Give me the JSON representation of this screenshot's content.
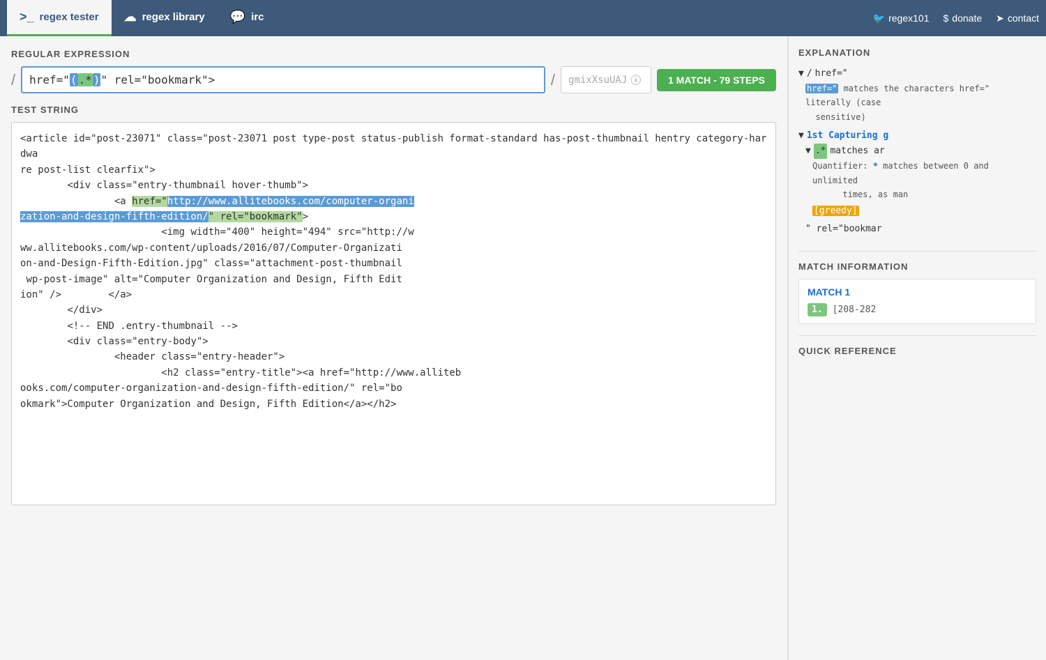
{
  "nav": {
    "tabs": [
      {
        "id": "regex-tester",
        "label": "regex tester",
        "icon": ">_",
        "active": true
      },
      {
        "id": "regex-library",
        "label": "regex library",
        "icon": "☁",
        "active": false
      },
      {
        "id": "irc",
        "label": "irc",
        "icon": "💬",
        "active": false
      }
    ],
    "right_links": [
      {
        "id": "twitter",
        "label": "regex101",
        "icon": "🐦"
      },
      {
        "id": "donate",
        "label": "donate",
        "icon": "$"
      },
      {
        "id": "contact",
        "label": "contact",
        "icon": "➤"
      }
    ]
  },
  "left": {
    "section_regex": "REGULAR EXPRESSION",
    "section_test": "TEST STRING",
    "match_badge": "1 MATCH - 79 STEPS",
    "regex_prefix": "/",
    "regex_suffix": "/",
    "flags_placeholder": "gmixXsuUAJ",
    "test_string": "<article id=\"post-23071\" class=\"post-23071 post type-post status-publish format-standard has-post-thumbnail hentry category-hardwa\nre post-list clearfix\">\n        <div class=\"entry-thumbnail hover-thumb\">\n                <a href=\"http://www.allitebooks.com/computer-organi\nzation-and-design-fifth-edition/\" rel=\"bookmark\">\n                        <img width=\"400\" height=\"494\" src=\"http://w\nww.allitebooks.com/wp-content/uploads/2016/07/Computer-Organizati\non-and-Design-Fifth-Edition.jpg\" class=\"attachment-post-thumbnail\n wp-post-image\" alt=\"Computer Organization and Design, Fifth Edit\nion\" />        </a>\n        </div>\n        <!-- END .entry-thumbnail -->\n        <div class=\"entry-body\">\n                <header class=\"entry-header\">\n                        <h2 class=\"entry-title\"><a href=\"http://www.alliteb\nooks.com/computer-organization-and-design-fifth-edition/\" rel=\"bo\nokmark\">Computer Organization and Design, Fifth Edition</a></h2>"
  },
  "right": {
    "explanation_title": "EXPLANATION",
    "exp_nodes": [
      {
        "depth": 0,
        "type": "collapse",
        "text": "/ href=\"",
        "token_type": "normal"
      },
      {
        "depth": 1,
        "text": "href=\" matches the characters href=\" literally (case sensitive)",
        "token_type": "desc"
      },
      {
        "depth": 0,
        "type": "collapse",
        "text": "1st Capturing g",
        "token_type": "blue"
      },
      {
        "depth": 1,
        "type": "collapse",
        "text": ".* matches ar",
        "token_type": "normal"
      },
      {
        "depth": 2,
        "text": "Quantifier: * matches between 0 and unlimited times, as man",
        "token_type": "desc"
      },
      {
        "depth": 2,
        "text": "[greedy]",
        "token_type": "orange"
      },
      {
        "depth": 1,
        "text": "\" rel=\"bookmar",
        "token_type": "normal"
      }
    ],
    "match_info_title": "MATCH INFORMATION",
    "match1_label": "MATCH 1",
    "match1_number": "1.",
    "match1_range": "[208-282",
    "quick_ref_title": "QUICK REFERENCE"
  }
}
